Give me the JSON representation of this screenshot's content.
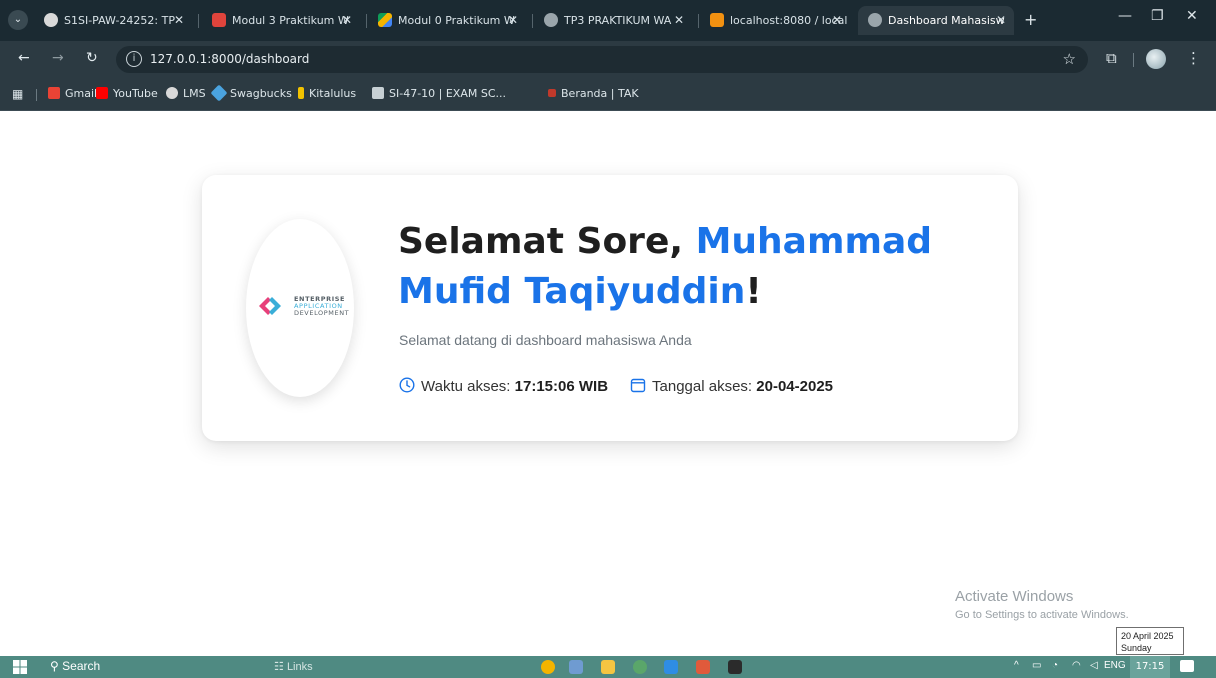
{
  "browser": {
    "tabs": [
      {
        "label": "S1SI-PAW-24252: TP",
        "icon": "lms-icon",
        "color": "#d9d9d9"
      },
      {
        "label": "Modul 3 Praktikum W",
        "icon": "pdf-icon",
        "color": "#e0443c"
      },
      {
        "label": "Modul 0 Praktikum W",
        "icon": "drive-icon",
        "color": "#f4b400"
      },
      {
        "label": "TP3 PRAKTIKUM WA",
        "icon": "globe-icon",
        "color": "#9aa5ab"
      },
      {
        "label": "localhost:8080 / local",
        "icon": "phpmyadmin-icon",
        "color": "#f29111"
      },
      {
        "label": "Dashboard Mahasisw",
        "icon": "globe-icon",
        "color": "#9aa5ab",
        "active": true
      }
    ],
    "url": "127.0.0.1:8000/dashboard",
    "bookmarks": [
      {
        "label": "Gmail",
        "icon": "gmail-icon",
        "color": "#ea4335"
      },
      {
        "label": "YouTube",
        "icon": "youtube-icon",
        "color": "#ff0000"
      },
      {
        "label": "LMS",
        "icon": "lms-icon",
        "color": "#d9d9d9"
      },
      {
        "label": "Swagbucks",
        "icon": "swagbucks-icon",
        "color": "#4aa3df"
      },
      {
        "label": "Kitalulus",
        "icon": "kitalulus-icon",
        "color": "#f2c200"
      },
      {
        "label": "SI-47-10 | EXAM SC...",
        "icon": "exam-icon",
        "color": "#c7d0d4"
      },
      {
        "label": "Beranda | TAK",
        "icon": "tak-icon",
        "color": "#c0392b"
      }
    ]
  },
  "dashboard": {
    "logo": {
      "line1": "ENTERPRISE",
      "line2": "APPLICATION",
      "line3": "DEVELOPMENT"
    },
    "greeting_prefix": "Selamat Sore,",
    "user_name": "Muhammad Mufid Taqiyuddin",
    "greeting_suffix": "!",
    "subtitle": "Selamat datang di dashboard mahasiswa Anda",
    "time_label": "Waktu akses:",
    "time_value": "17:15:06 WIB",
    "date_label": "Tanggal akses:",
    "date_value": "20-04-2025",
    "accent_color": "#1a73e8"
  },
  "watermark": {
    "title": "Activate Windows",
    "subtitle": "Go to Settings to activate Windows."
  },
  "tooltip": {
    "date": "20 April 2025",
    "day": "Sunday"
  },
  "taskbar": {
    "search_label": "Search",
    "links_label": "Links",
    "language": "ENG",
    "clock": "17:15"
  }
}
